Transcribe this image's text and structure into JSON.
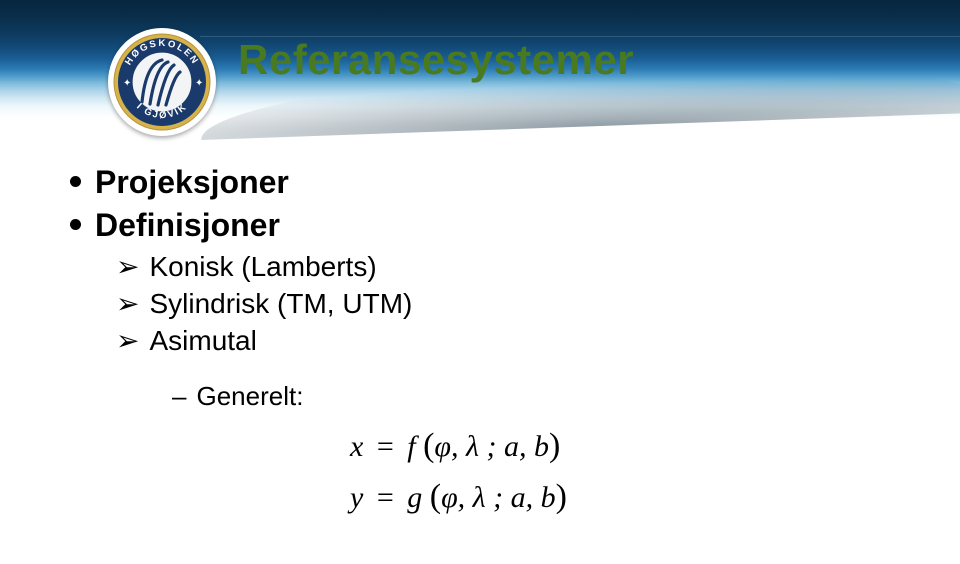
{
  "slide": {
    "title": "Referansesystemer",
    "logo": {
      "name": "hogskolen-i-gjovik-logo",
      "ring_text_top": "HØGSKOLEN",
      "ring_text_bottom": "I GJØVIK"
    },
    "bullets": {
      "lvl1_projeksjoner": "Projeksjoner",
      "lvl1_definisjoner": "Definisjoner",
      "lvl2_konisk": "Konisk (Lamberts)",
      "lvl2_sylindrisk": "Sylindrisk (TM, UTM)",
      "lvl2_asimutal": "Asimutal",
      "lvl3_generelt": "Generelt:"
    },
    "formulas": {
      "line1_lhs": "x",
      "line1_eq": "=",
      "line1_fn": "f",
      "line1_args": "φ, λ ; a, b",
      "line2_lhs": "y",
      "line2_eq": "=",
      "line2_fn": "g",
      "line2_args": "φ, λ ; a, b"
    },
    "colors": {
      "title_green": "#4a7a1f",
      "banner_dark": "#0a2e4b"
    }
  }
}
